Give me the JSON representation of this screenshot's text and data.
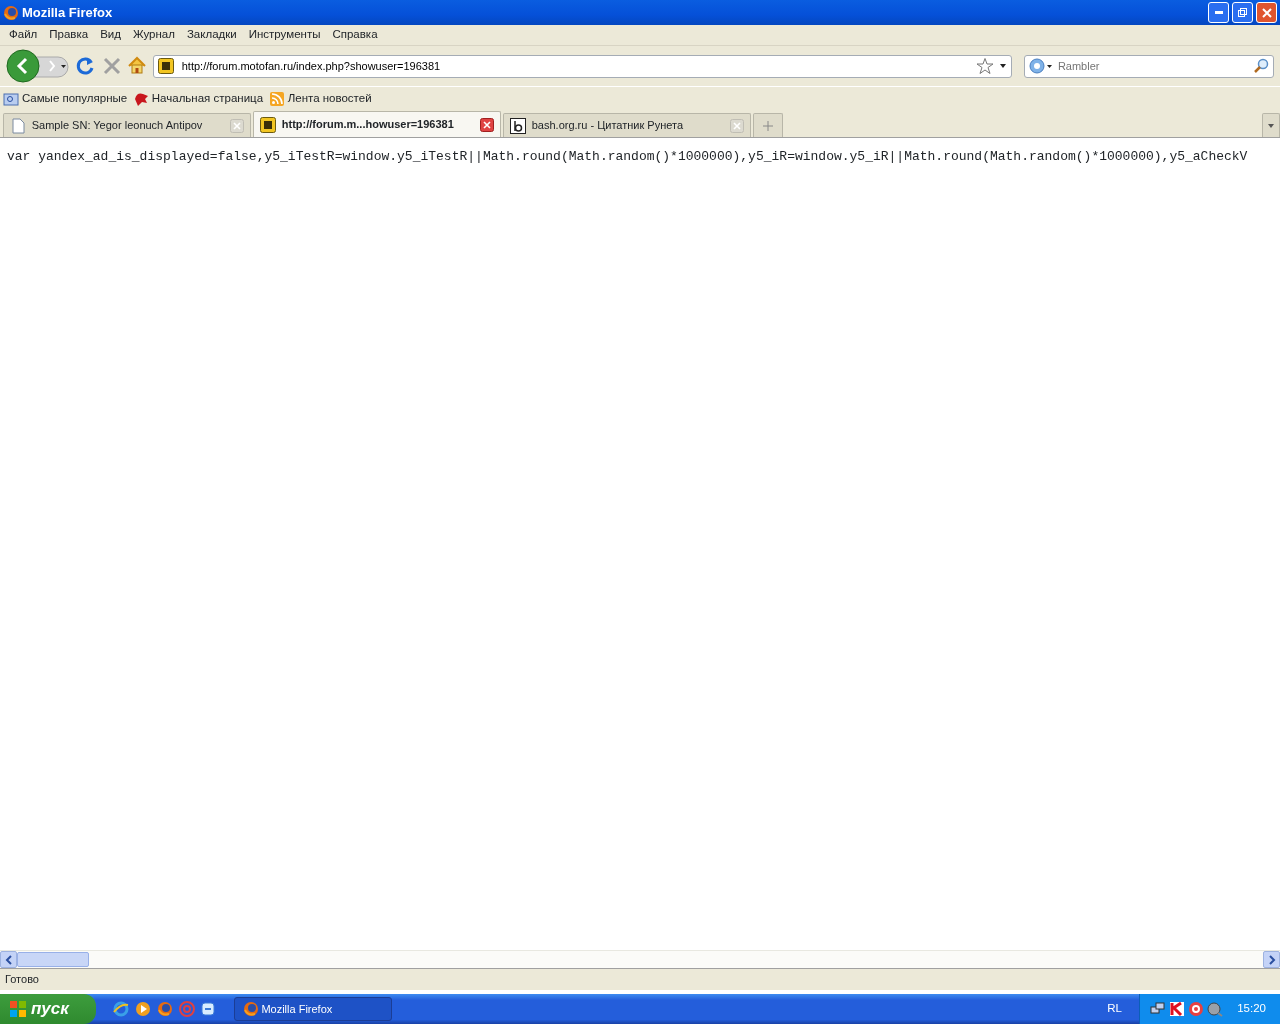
{
  "window": {
    "title": "Mozilla Firefox"
  },
  "menu": [
    "Файл",
    "Правка",
    "Вид",
    "Журнал",
    "Закладки",
    "Инструменты",
    "Справка"
  ],
  "address": {
    "value": "http://forum.motofan.ru/index.php?showuser=196381"
  },
  "search": {
    "placeholder": "Rambler"
  },
  "bookmarks": [
    {
      "label": "Самые популярные",
      "kind": "folder"
    },
    {
      "label": "Начальная страница",
      "kind": "site"
    },
    {
      "label": "Лента новостей",
      "kind": "feed"
    }
  ],
  "tabs": [
    {
      "label": "Sample SN: Yegor leonuch Antipov",
      "kind": "page",
      "selected": false
    },
    {
      "label": "http://forum.m...howuser=196381",
      "kind": "motofan",
      "selected": true
    },
    {
      "label": "bash.org.ru - Цитатник Рунета",
      "kind": "bash",
      "selected": false
    }
  ],
  "page_text": "var yandex_ad_is_displayed=false,y5_iTestR=window.y5_iTestR||Math.round(Math.random()*1000000),y5_iR=window.y5_iR||Math.round(Math.random()*1000000),y5_aCheckV",
  "status_bar": "Готово",
  "taskbar": {
    "start": "пуск",
    "tasks": [
      {
        "label": "Mozilla Firefox",
        "selected": false
      }
    ],
    "language": "RL",
    "clock": "15:20"
  }
}
